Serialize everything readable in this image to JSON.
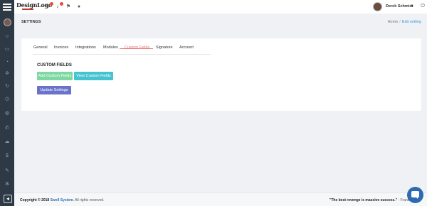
{
  "topbar": {
    "logo_text": "DesignLogo",
    "user_name": "Derek Schmidt",
    "icons": [
      "mail-icon",
      "bell-icon",
      "flag-icon",
      "chat-icon",
      "power-icon"
    ]
  },
  "sidebar": {
    "icons": [
      "user-icon",
      "folder-icon",
      "bell-icon",
      "gear-icon",
      "refresh-icon",
      "clock-icon",
      "globe-icon",
      "phone-icon",
      "cloud-icon",
      "dollar-icon",
      "edit-icon",
      "settings-icon"
    ]
  },
  "page": {
    "title": "SETTINGS",
    "breadcrumb": [
      "Home",
      "Edit setting"
    ]
  },
  "tabs": [
    "General",
    "Invoices",
    "Integrations",
    "Modules",
    "Custom Fields",
    "Signature",
    "Account"
  ],
  "active_tab": "Custom Fields",
  "section": {
    "title": "CUSTOM FIELDS",
    "add_button": "Add Custom Fields",
    "view_button": "View Custom Fields",
    "update_button": "Update Settings"
  },
  "footer": {
    "copyright_prefix": "Copyright © 2018",
    "brand": "Swell System.",
    "rights": "All rights reserved.",
    "quote": "\"The best revenge is massive success.\"",
    "quote_author": "- Frank S"
  },
  "colors": {
    "sidebar": "#2d3a45",
    "active_tab": "#e97777",
    "add_button": "#7dd8a2",
    "view_button": "#45c3d1",
    "update_button": "#6a73c9",
    "chat_button": "#2b6cb0"
  }
}
